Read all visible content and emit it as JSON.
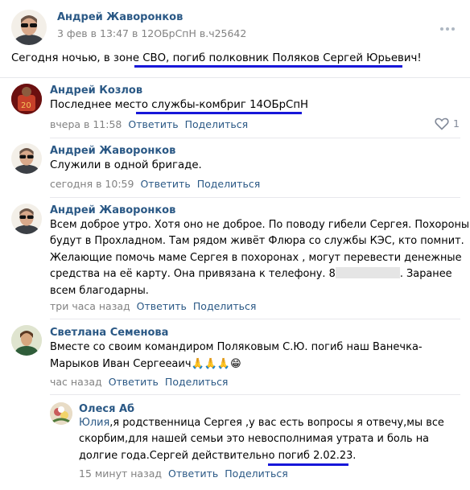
{
  "post": {
    "author": "Андрей Жаворонков",
    "meta": "3 фев в 13:47 в 12ОБрСпН в.ч25642",
    "text_prefix": "Сегодня ночью, в зоне ",
    "text_underlined": "СВО, погиб полковник Поляков Сергей Юрьевич!",
    "more_icon": "more-horizontal-icon"
  },
  "comments": [
    {
      "author": "Андрей Козлов",
      "text_prefix": "Последнее мест",
      "text_underlined": "о службы-комбриг 14ОБрСпН",
      "time": "вчера в 11:58",
      "reply": "Ответить",
      "share": "Поделиться",
      "likes": "1"
    },
    {
      "author": "Андрей Жаворонков",
      "text": "Служили в одной бригаде.",
      "time": "сегодня в 10:59",
      "reply": "Ответить",
      "share": "Поделиться"
    },
    {
      "author": "Андрей Жаворонков",
      "lines": [
        "Всем доброе утро. Хотя оно не доброе. По поводу гибели Сергея. Похороны",
        "будут в Прохладном. Там рядом живёт Флюра со службы КЭС, кто помнит.",
        "Желающие помочь маме Сергея в похоронах , могут перевести денежные",
        "средства на её карту. Она привязана к телефону. 8"
      ],
      "line4_suffix": ". Заранее",
      "line5": "всем благодарны.",
      "time": "три часа назад",
      "reply": "Ответить",
      "share": "Поделиться"
    },
    {
      "author": "Светлана Семенова",
      "line1": "Вместе со своим командиром Поляковым С.Ю. погиб наш Ванечка-",
      "line2": "Марыков Иван Сергееаич",
      "emoji": "🙏🙏🙏😁",
      "time": "час назад",
      "reply": "Ответить",
      "share": "Поделиться"
    },
    {
      "author": "Олеся Аб",
      "line1_name": "Юлия",
      "line1": ",я родственница Сергея ,у вас есть вопросы я отвечу,мы все",
      "line2": "скорбим,для нашей семьи это невосполнимая утрата и боль на",
      "line3_prefix": "долгие года.Сергей действительно ",
      "line3_underlined": "погиб 2.02.23.",
      "time": "15 минут назад",
      "reply": "Ответить",
      "share": "Поделиться"
    }
  ],
  "colors": {
    "link": "#2a5885",
    "meta": "#828282",
    "underline": "#1717d9"
  }
}
